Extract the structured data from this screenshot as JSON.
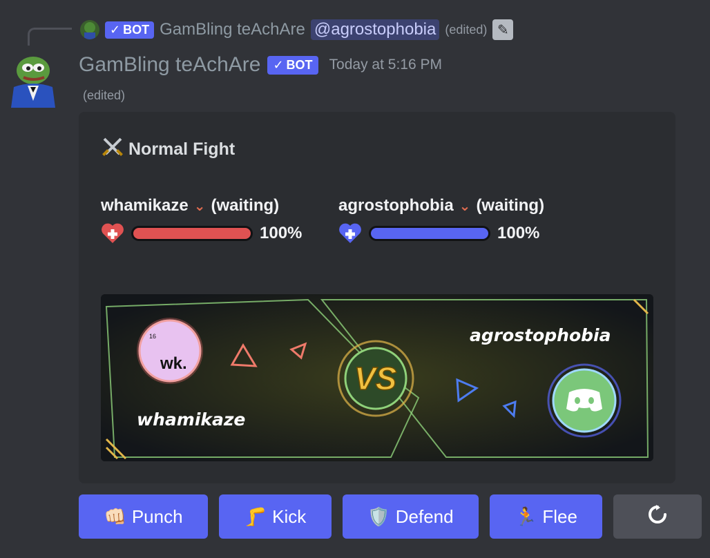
{
  "reply": {
    "bot_label": "BOT",
    "author": "GamBling teAchAre",
    "mention": "@agrostophobia",
    "edited": "(edited)"
  },
  "message": {
    "author": "GamBling teAchAre",
    "bot_label": "BOT",
    "timestamp": "Today at 5:16 PM",
    "edited": "(edited)"
  },
  "embed": {
    "title_icon": "crossed-swords-icon",
    "title": "Normal Fight",
    "fighters": [
      {
        "name": "whamikaze",
        "status": "(waiting)",
        "hp_label": "100%",
        "hp": 1.0,
        "color": "#e05252"
      },
      {
        "name": "agrostophobia",
        "status": "(waiting)",
        "hp_label": "100%",
        "hp": 1.0,
        "color": "#5865f2"
      }
    ],
    "banner": {
      "left_avatar_text": "wk.",
      "left_avatar_small": "16",
      "left_name": "whamikaze",
      "vs": "VS",
      "right_name": "agrostophobia"
    }
  },
  "buttons": [
    {
      "label": "Punch",
      "emoji": "👊🏻"
    },
    {
      "label": "Kick",
      "emoji": "🦵"
    },
    {
      "label": "Defend",
      "emoji": "🛡️"
    },
    {
      "label": "Flee",
      "emoji": "🏃"
    }
  ],
  "colors": {
    "blurple": "#5865f2",
    "background": "#313338",
    "embed": "#2b2d31"
  }
}
